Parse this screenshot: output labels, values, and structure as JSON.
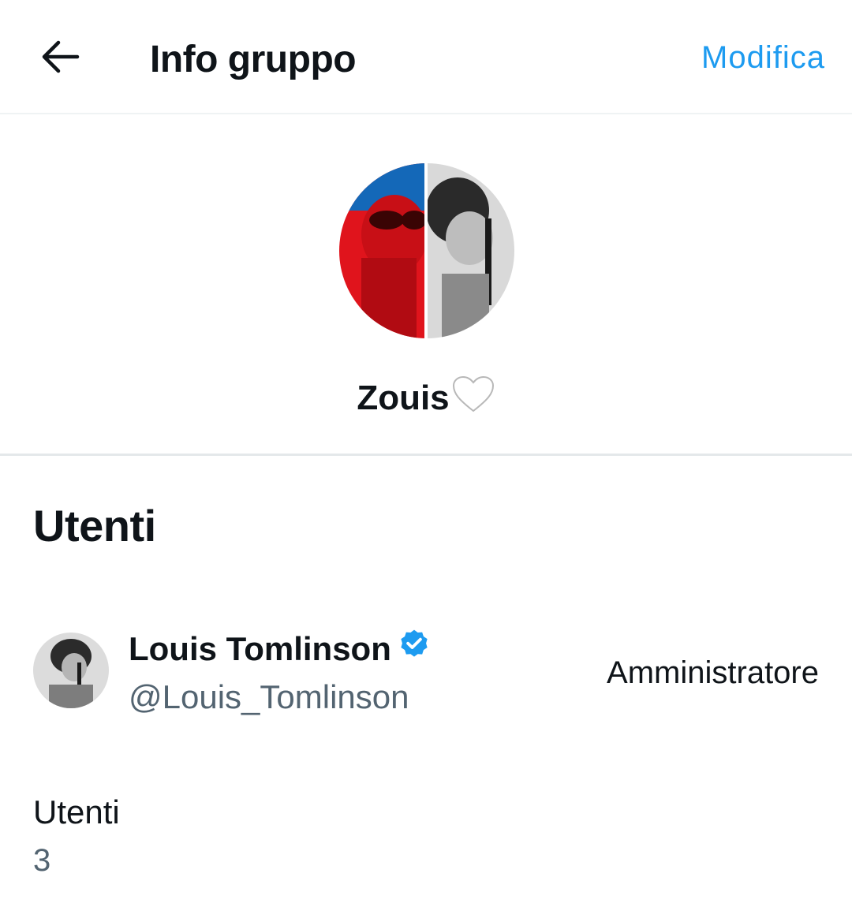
{
  "header": {
    "back_icon": "arrow-left-icon",
    "title": "Info gruppo",
    "edit_label": "Modifica"
  },
  "group": {
    "name": "Zouis",
    "name_emoji_icon": "white-heart-icon"
  },
  "users_section": {
    "heading": "Utenti",
    "members": [
      {
        "display_name": "Louis Tomlinson",
        "verified_icon": "verified-badge-icon",
        "handle": "@Louis_Tomlinson",
        "role": "Amministratore"
      }
    ]
  },
  "users_count": {
    "label": "Utenti",
    "value": "3"
  },
  "colors": {
    "accent": "#1d9bf0",
    "text_primary": "#0f1419",
    "text_secondary": "#536471",
    "divider": "#eff3f4"
  }
}
